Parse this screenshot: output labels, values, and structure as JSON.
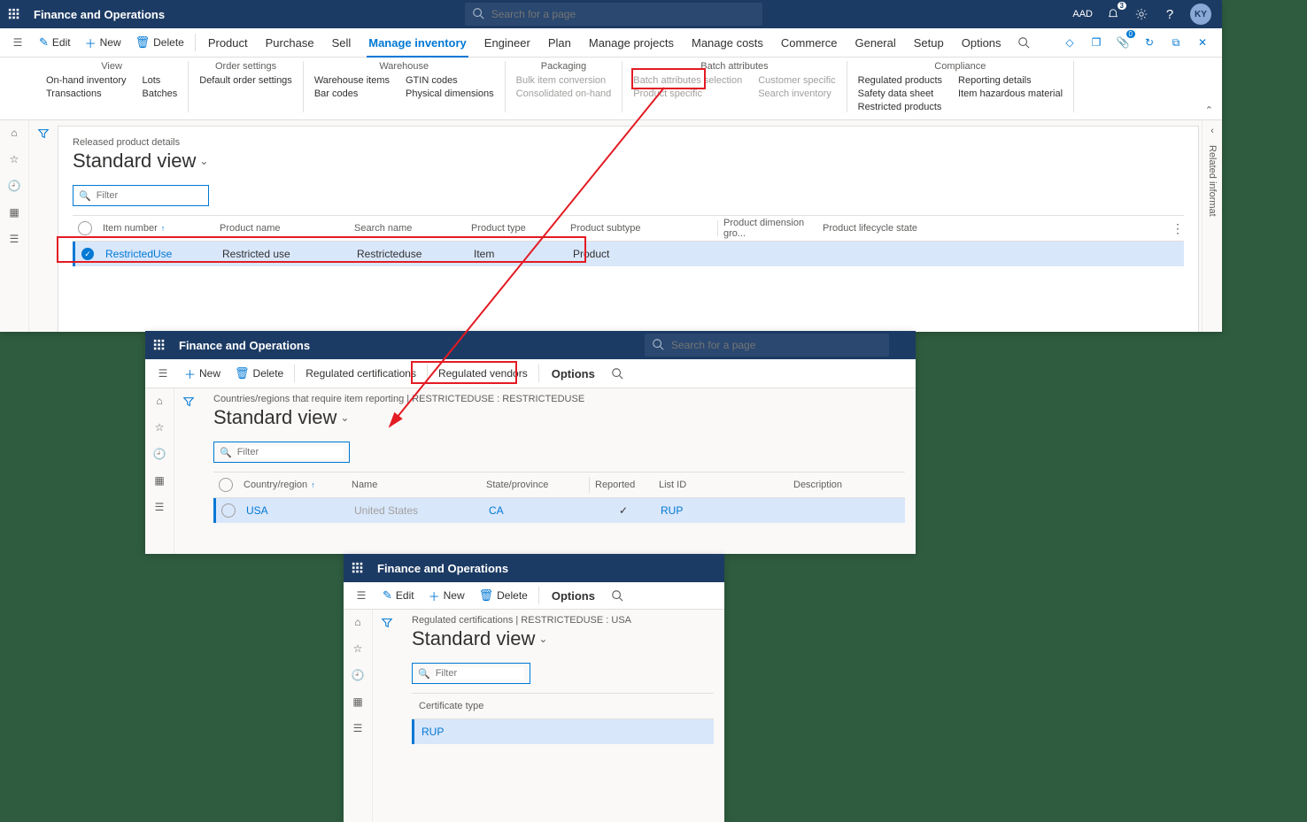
{
  "common": {
    "app_name": "Finance and Operations",
    "search_placeholder": "Search for a page",
    "tenant": "AAD",
    "avatar_initials": "KY",
    "notification_count": "3",
    "attachment_count": "0",
    "standard_view": "Standard view",
    "filter_placeholder": "Filter",
    "related_info": "Related informat"
  },
  "w1": {
    "cmd": {
      "edit": "Edit",
      "new": "New",
      "delete": "Delete"
    },
    "tabs": [
      "Product",
      "Purchase",
      "Sell",
      "Manage inventory",
      "Engineer",
      "Plan",
      "Manage projects",
      "Manage costs",
      "Commerce",
      "General",
      "Setup",
      "Options"
    ],
    "active_tab": "Manage inventory",
    "ribbon": {
      "view": {
        "hdr": "View",
        "items": [
          [
            "On-hand inventory",
            "Transactions"
          ],
          [
            "Lots",
            "Batches"
          ]
        ]
      },
      "order": {
        "hdr": "Order settings",
        "items": [
          [
            "Default order settings"
          ]
        ]
      },
      "warehouse": {
        "hdr": "Warehouse",
        "items": [
          [
            "Warehouse items",
            "Bar codes"
          ],
          [
            "GTIN codes",
            "Physical dimensions"
          ]
        ]
      },
      "packaging": {
        "hdr": "Packaging",
        "items_disabled": [
          [
            "Bulk item conversion",
            "Consolidated on-hand"
          ]
        ]
      },
      "batch": {
        "hdr": "Batch attributes",
        "items_disabled": [
          [
            "Batch attributes selection",
            "Product specific"
          ],
          [
            "Customer specific",
            "Search inventory"
          ]
        ]
      },
      "compliance": {
        "hdr": "Compliance",
        "items": [
          [
            "Regulated products",
            "Safety data sheet",
            "Restricted products"
          ],
          [
            "Reporting details",
            "Item hazardous material"
          ]
        ]
      }
    },
    "breadcrumb": "Released product details",
    "grid": {
      "headers": [
        "Item number",
        "Product name",
        "Search name",
        "Product type",
        "Product subtype",
        "Product dimension gro...",
        "Product lifecycle state"
      ],
      "row": {
        "item": "RestrictedUse",
        "pname": "Restricted use",
        "sname": "Restricteduse",
        "ptype": "Item",
        "psub": "Product"
      }
    }
  },
  "w2": {
    "cmd": {
      "new": "New",
      "delete": "Delete",
      "regcert": "Regulated certifications",
      "regvend": "Regulated vendors",
      "options": "Options"
    },
    "breadcrumb": "Countries/regions that require item reporting   |   RESTRICTEDUSE : RESTRICTEDUSE",
    "grid": {
      "headers": [
        "Country/region",
        "Name",
        "State/province",
        "Reported",
        "List ID",
        "Description"
      ],
      "row": {
        "country": "USA",
        "name": "United States",
        "state": "CA",
        "reported": "✓",
        "listid": "RUP"
      }
    }
  },
  "w3": {
    "cmd": {
      "edit": "Edit",
      "new": "New",
      "delete": "Delete",
      "options": "Options"
    },
    "breadcrumb": "Regulated certifications   |   RESTRICTEDUSE : USA",
    "grid": {
      "header": "Certificate type",
      "row": "RUP"
    }
  }
}
